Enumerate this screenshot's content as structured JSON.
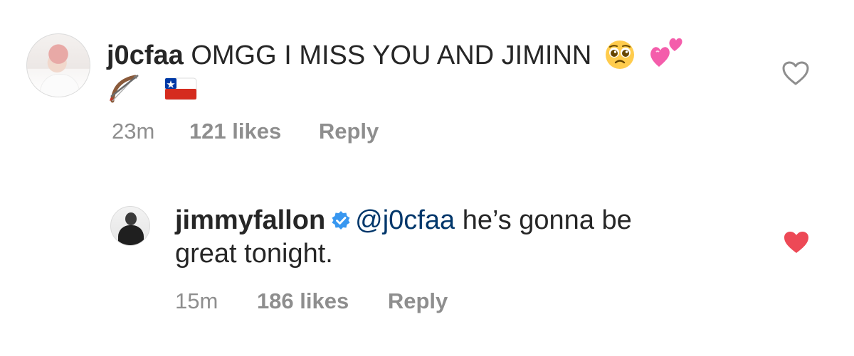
{
  "comments": [
    {
      "username": "j0cfaa",
      "text_line1": "OMGG I MISS YOU AND JIMINN",
      "emoji_line1": [
        "pleading-face-emoji",
        "two-hearts-emoji"
      ],
      "emoji_line2": [
        "bow-and-arrow-emoji",
        "flag-chile-emoji"
      ],
      "time": "23m",
      "likes": "121 likes",
      "reply": "Reply",
      "liked": false
    },
    {
      "username": "jimmyfallon",
      "verified": true,
      "mention": "@j0cfaa",
      "text_line1": " he’s gonna be",
      "text_line2": "great tonight.",
      "time": "15m",
      "likes": "186 likes",
      "reply": "Reply",
      "liked": true
    }
  ],
  "colors": {
    "text": "#262626",
    "meta": "#8e8e8e",
    "heart_liked": "#ed4956",
    "verified": "#3897f0",
    "mention": "#00376b"
  }
}
